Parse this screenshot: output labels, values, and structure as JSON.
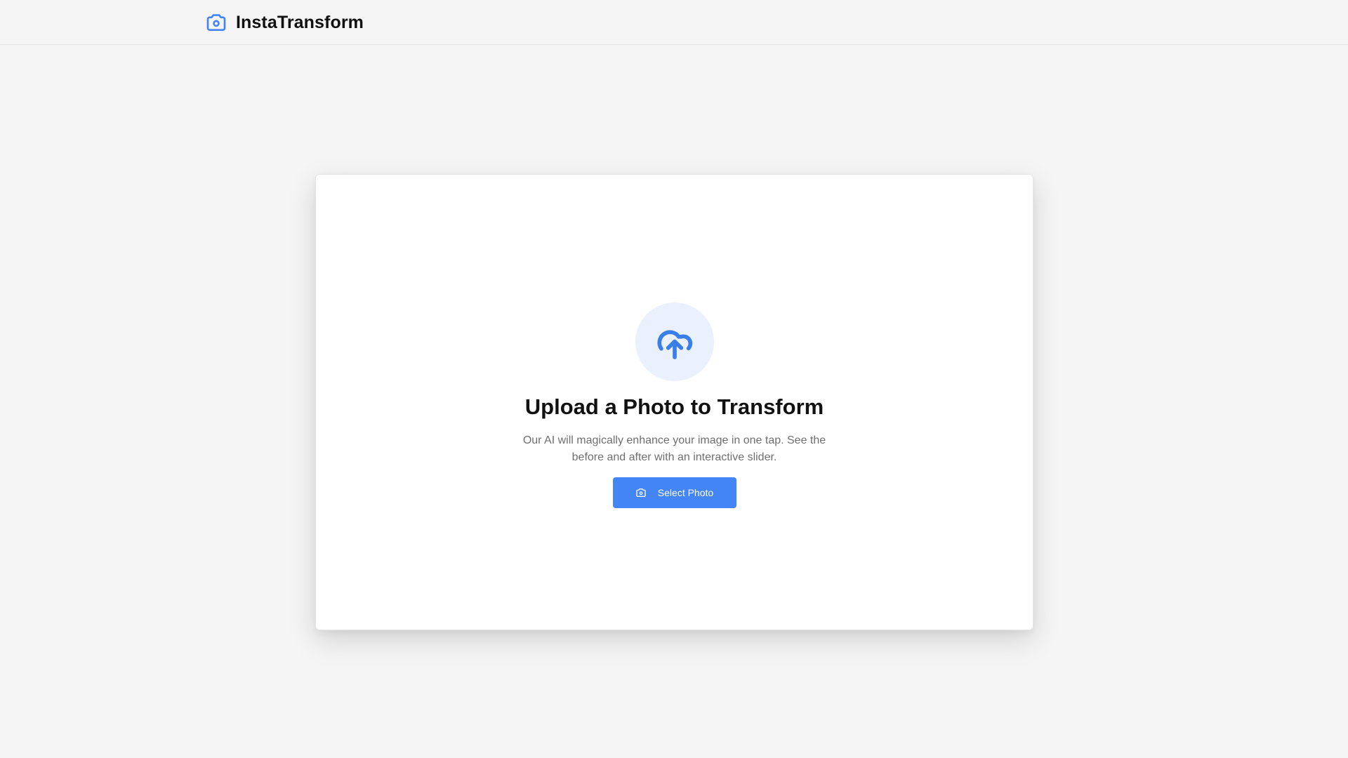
{
  "app": {
    "name": "InstaTransform",
    "logo_icon": "camera-icon",
    "accent_color": "#4385f5"
  },
  "upload": {
    "icon": "cloud-upload-icon",
    "title": "Upload a Photo to Transform",
    "description": "Our AI will magically enhance your image in one tap. See the before and after with an interactive slider.",
    "button_label": "Select Photo",
    "button_icon": "camera-icon"
  }
}
